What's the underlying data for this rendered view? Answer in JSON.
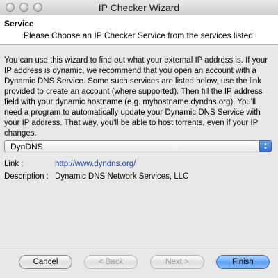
{
  "window": {
    "title": "IP Checker Wizard"
  },
  "header": {
    "title": "Service",
    "subtitle": "Please Choose an IP Checker Service from the services listed"
  },
  "description": "You can use this wizard to find out what your external IP address is. If your IP address is dynamic, we recommend that you open an account with a Dynamic DNS Service. Some such services are listed below, use the link provided to create an account (where supported). Then fill the IP address field with your dynamic hostname (e.g. myhostname.dyndns.org). You'll need a program to automatically update your Dynamic DNS Service with your IP address. That way, you'll be able to host torrents, even if your IP changes.",
  "service_select": {
    "selected": "DynDNS"
  },
  "details": {
    "link_label": "Link :",
    "link_value": "http://www.dyndns.org/",
    "description_label": "Description :",
    "description_value": "Dynamic DNS Network Services, LLC"
  },
  "buttons": {
    "cancel": "Cancel",
    "back": "< Back",
    "next": "Next >",
    "finish": "Finish"
  }
}
